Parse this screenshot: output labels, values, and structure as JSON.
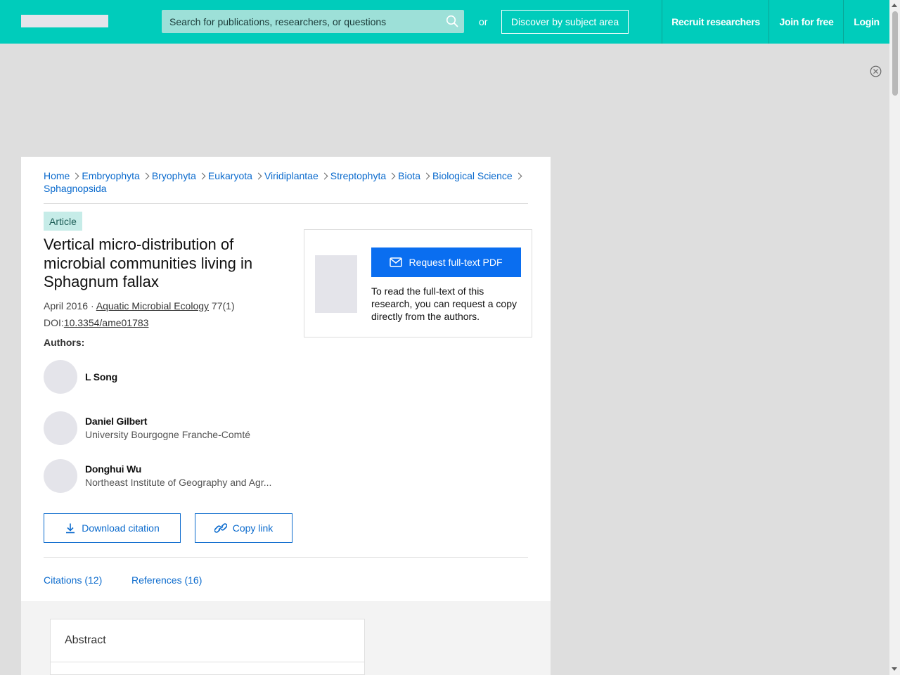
{
  "header": {
    "search_placeholder": "Search for publications, researchers, or questions",
    "or_label": "or",
    "discover_label": "Discover by subject area",
    "recruit_label": "Recruit researchers",
    "join_label": "Join for free",
    "login_label": "Login"
  },
  "breadcrumb": [
    "Home",
    "Embryophyta",
    "Bryophyta",
    "Eukaryota",
    "Viridiplantae",
    "Streptophyta",
    "Biota",
    "Biological Science",
    "Sphagnopsida"
  ],
  "article": {
    "badge": "Article",
    "title": "Vertical micro-distribution of microbial communities living in Sphagnum fallax",
    "date": "April 2016",
    "separator": "·",
    "journal": "Aquatic Microbial Ecology",
    "issue": "77(1)",
    "doi_prefix": "DOI:",
    "doi": "10.3354/ame01783",
    "authors_label": "Authors:"
  },
  "authors": [
    {
      "name": "L Song",
      "institution": ""
    },
    {
      "name": "Daniel Gilbert",
      "institution": "University Bourgogne Franche-Comté"
    },
    {
      "name": "Donghui Wu",
      "institution": "Northeast Institute of Geography and Agr..."
    }
  ],
  "actions": {
    "download_citation": "Download citation",
    "copy_link": "Copy link"
  },
  "tabs": {
    "citations": "Citations (12)",
    "references": "References (16)"
  },
  "request": {
    "button_label": "Request full-text PDF",
    "description": "To read the full-text of this research, you can request a copy directly from the authors."
  },
  "abstract": {
    "title": "Abstract"
  },
  "colors": {
    "brand": "#00ccbb",
    "link": "#0a6acd",
    "primary_button": "#0a6ef0"
  }
}
